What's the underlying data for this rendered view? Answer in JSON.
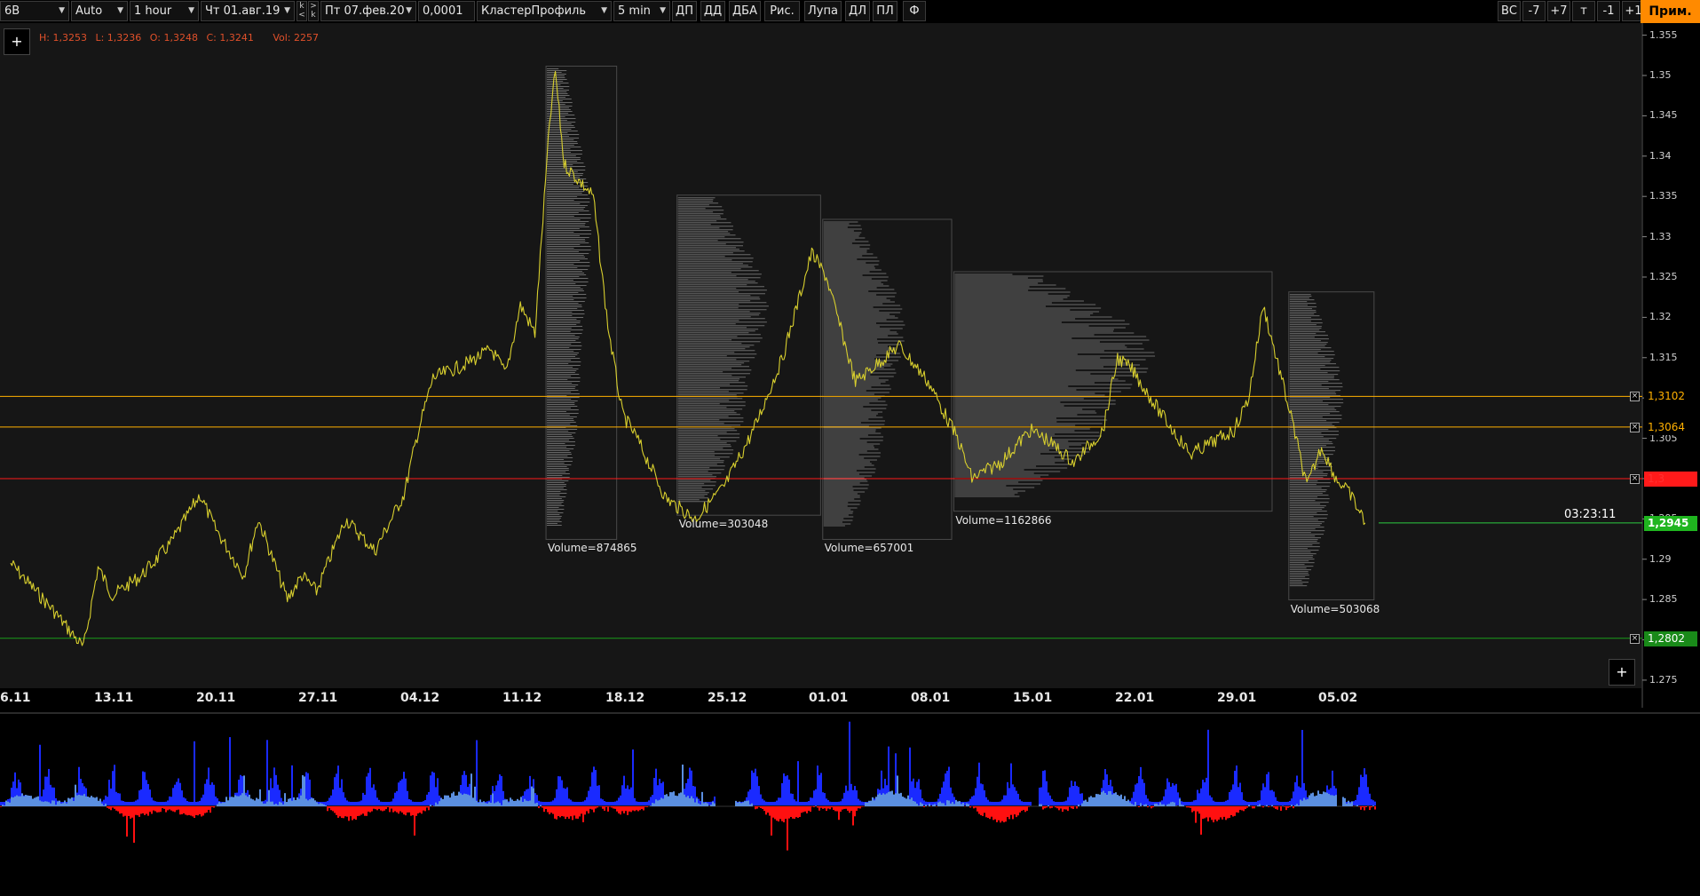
{
  "toolbar": {
    "symbol": "6B",
    "scale": "Auto",
    "timeframe": "1 hour",
    "date_from": "Чт 01.авг.19",
    "date_to": "Пт 07.фев.20",
    "tick_size": "0,0001",
    "spin1_up": "k",
    "spin1_down": "<",
    "spin2_up": ">",
    "spin2_down": "k",
    "indicator": "КластерПрофиль",
    "profile_tf": "5 min",
    "buttons": [
      "ДП",
      "ДД",
      "ДБА",
      "Рис.",
      "Лупа",
      "ДЛ",
      "ПЛ",
      "Ф"
    ],
    "right_buttons": [
      "ВС",
      "-7",
      "+7",
      "т",
      "-1",
      "+1"
    ],
    "prim": "Прим."
  },
  "ohlc": {
    "h": "H: 1,3253",
    "l": "L: 1,3236",
    "o": "O: 1,3248",
    "c": "C: 1,3241",
    "vol": "Vol: 2257"
  },
  "timer": "03:23:11",
  "plus_label": "+",
  "chart_data": {
    "type": "line",
    "y_axis": {
      "ticks": [
        "1.355",
        "1.35",
        "1.345",
        "1.34",
        "1.335",
        "1.33",
        "1.325",
        "1.32",
        "1.315",
        "1.31",
        "1.305",
        "1.3",
        "1.295",
        "1.29",
        "1.285",
        "1.28",
        "1.275"
      ],
      "range": [
        1.274,
        1.3565
      ]
    },
    "x_axis": {
      "ticks": [
        "6.11",
        "13.11",
        "20.11",
        "27.11",
        "04.12",
        "11.12",
        "18.12",
        "25.12",
        "01.01",
        "08.01",
        "15.01",
        "22.01",
        "29.01",
        "05.02"
      ]
    },
    "price_series": [
      {
        "date": "6.11",
        "price": 1.2895
      },
      {
        "date": "9.11",
        "price": 1.2835
      },
      {
        "date": "11.11",
        "price": 1.279
      },
      {
        "date": "12.11",
        "price": 1.289
      },
      {
        "date": "13.11",
        "price": 1.2855
      },
      {
        "date": "15.11",
        "price": 1.288
      },
      {
        "date": "17.11",
        "price": 1.292
      },
      {
        "date": "19.11",
        "price": 1.298
      },
      {
        "date": "20.11",
        "price": 1.294
      },
      {
        "date": "22.11",
        "price": 1.288
      },
      {
        "date": "23.11",
        "price": 1.295
      },
      {
        "date": "25.11",
        "price": 1.285
      },
      {
        "date": "26.11",
        "price": 1.288
      },
      {
        "date": "27.11",
        "price": 1.286
      },
      {
        "date": "29.11",
        "price": 1.295
      },
      {
        "date": "01.12",
        "price": 1.291
      },
      {
        "date": "03.12",
        "price": 1.298
      },
      {
        "date": "04.12",
        "price": 1.306
      },
      {
        "date": "05.12",
        "price": 1.3125
      },
      {
        "date": "07.12",
        "price": 1.314
      },
      {
        "date": "09.12",
        "price": 1.316
      },
      {
        "date": "10.12",
        "price": 1.313
      },
      {
        "date": "11.12",
        "price": 1.3215
      },
      {
        "date": "12.12",
        "price": 1.318
      },
      {
        "date": "13.12",
        "price": 1.344
      },
      {
        "date": "13.12 b",
        "price": 1.3505
      },
      {
        "date": "14.12",
        "price": 1.339
      },
      {
        "date": "15.12",
        "price": 1.337
      },
      {
        "date": "16.12",
        "price": 1.335
      },
      {
        "date": "17.12",
        "price": 1.319
      },
      {
        "date": "18.12",
        "price": 1.308
      },
      {
        "date": "19.12",
        "price": 1.305
      },
      {
        "date": "21.12",
        "price": 1.2975
      },
      {
        "date": "23.12",
        "price": 1.295
      },
      {
        "date": "25.12",
        "price": 1.299
      },
      {
        "date": "27.12",
        "price": 1.306
      },
      {
        "date": "29.12",
        "price": 1.315
      },
      {
        "date": "31.12",
        "price": 1.328
      },
      {
        "date": "01.01",
        "price": 1.325
      },
      {
        "date": "03.01",
        "price": 1.312
      },
      {
        "date": "05.01",
        "price": 1.315
      },
      {
        "date": "06.01",
        "price": 1.3165
      },
      {
        "date": "08.01",
        "price": 1.312
      },
      {
        "date": "10.01",
        "price": 1.305
      },
      {
        "date": "11.01",
        "price": 1.3
      },
      {
        "date": "13.01",
        "price": 1.302
      },
      {
        "date": "15.01",
        "price": 1.306
      },
      {
        "date": "16.01",
        "price": 1.305
      },
      {
        "date": "18.01",
        "price": 1.302
      },
      {
        "date": "20.01",
        "price": 1.306
      },
      {
        "date": "21.01",
        "price": 1.315
      },
      {
        "date": "22.01",
        "price": 1.3135
      },
      {
        "date": "24.01",
        "price": 1.308
      },
      {
        "date": "26.01",
        "price": 1.303
      },
      {
        "date": "28.01",
        "price": 1.305
      },
      {
        "date": "29.01",
        "price": 1.306
      },
      {
        "date": "30.01",
        "price": 1.31
      },
      {
        "date": "31.01",
        "price": 1.3215
      },
      {
        "date": "02.02",
        "price": 1.307
      },
      {
        "date": "03.02",
        "price": 1.299
      },
      {
        "date": "04.02",
        "price": 1.304
      },
      {
        "date": "05.02",
        "price": 1.3
      },
      {
        "date": "06.02",
        "price": 1.298
      },
      {
        "date": "07.02",
        "price": 1.2945
      }
    ],
    "levels": [
      {
        "value": "1,3102",
        "price": 1.3102,
        "color": "#ffb000",
        "text_color": "#ffb000",
        "bg": "#000000"
      },
      {
        "value": "1,3064",
        "price": 1.3064,
        "color": "#ffb000",
        "text_color": "#ffb000",
        "bg": "#000000"
      },
      {
        "value": "1,3",
        "price": 1.3,
        "color": "#ff1a1a",
        "text_color": "#ff3030",
        "bg": "#ff1a1a"
      },
      {
        "value": "1,2945",
        "price": 1.2945,
        "color": "#2ecc40",
        "text_color": "#ffffff",
        "bg": "#1fb51f"
      },
      {
        "value": "1,2802",
        "price": 1.2802,
        "color": "#1a9e1a",
        "text_color": "#ffffff",
        "bg": "#198a19"
      }
    ],
    "profiles": [
      {
        "label": "Volume=874865",
        "from": "13.12",
        "to": "17.12",
        "high": 1.3505,
        "low": 1.294
      },
      {
        "label": "Volume=303048",
        "from": "22.12",
        "to": "31.12",
        "high": 1.3345,
        "low": 1.297
      },
      {
        "label": "Volume=657001",
        "from": "01.01",
        "to": "09.01",
        "high": 1.3315,
        "low": 1.294
      },
      {
        "label": "Volume=1162866",
        "from": "10.01",
        "to": "31.01",
        "high": 1.325,
        "low": 1.2975
      },
      {
        "label": "Volume=503068",
        "from": "02.02",
        "to": "07.02",
        "high": 1.3225,
        "low": 1.2865
      }
    ],
    "volume_color": "#1a2aff",
    "delta_pos_color": "#5b8fe0",
    "delta_neg_color": "#ff1010",
    "price_color": "#d8cf2e"
  }
}
